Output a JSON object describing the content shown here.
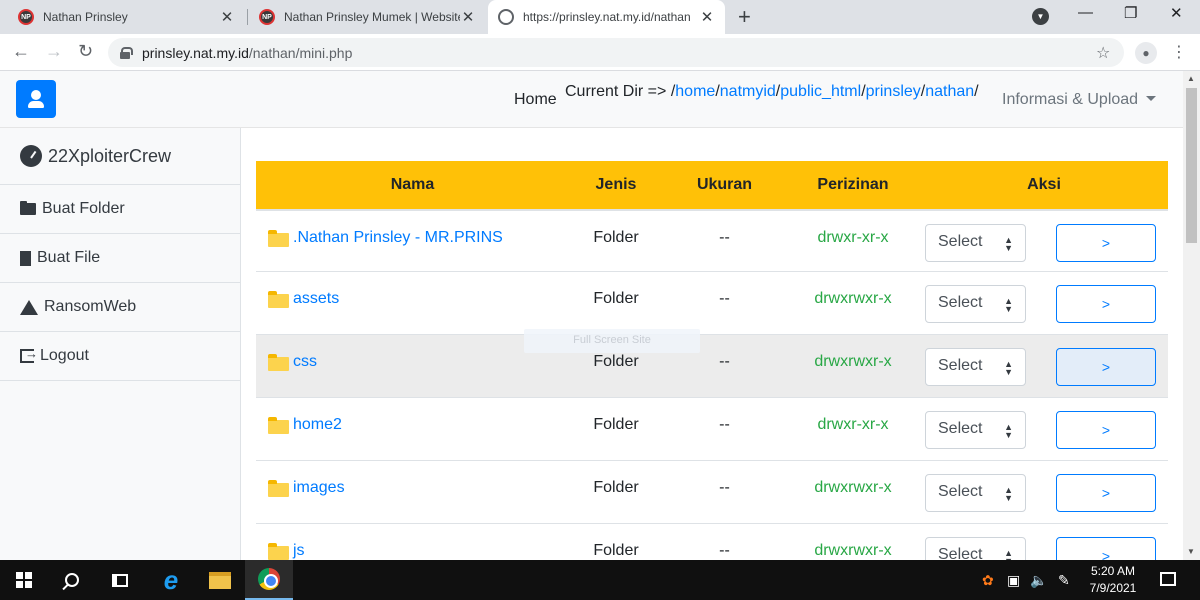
{
  "browser": {
    "tabs": [
      {
        "title": "Nathan Prinsley",
        "fav": "NP"
      },
      {
        "title": "Nathan Prinsley Mumek | Website",
        "fav": "NP"
      },
      {
        "title": "https://prinsley.nat.my.id/nathan",
        "fav": ""
      }
    ],
    "url_host": "prinsley.nat.my.id",
    "url_path": "/nathan/mini.php"
  },
  "topnav": {
    "home": "Home",
    "current_dir_label": "Current Dir =>",
    "path_sep": "/",
    "path_parts": [
      "home",
      "natmyid",
      "public_html",
      "prinsley",
      "nathan"
    ],
    "info_upload": "Informasi & Upload"
  },
  "sidebar": {
    "brand": "22XploiterCrew",
    "items": [
      {
        "label": "Buat Folder",
        "icon": "folder-open-icon"
      },
      {
        "label": "Buat File",
        "icon": "file-icon"
      },
      {
        "label": "RansomWeb",
        "icon": "warning-icon"
      },
      {
        "label": "Logout",
        "icon": "sign-out-icon"
      }
    ]
  },
  "table": {
    "headers": {
      "nama": "Nama",
      "jenis": "Jenis",
      "ukuran": "Ukuran",
      "perizinan": "Perizinan",
      "aksi": "Aksi"
    },
    "select_label": "Select",
    "go_label": ">",
    "rows": [
      {
        "name": ".Nathan Prinsley - MR.PRINS",
        "type": "Folder",
        "size": "--",
        "perm": "drwxr-xr-x"
      },
      {
        "name": "assets",
        "type": "Folder",
        "size": "--",
        "perm": "drwxrwxr-x"
      },
      {
        "name": "css",
        "type": "Folder",
        "size": "--",
        "perm": "drwxrwxr-x"
      },
      {
        "name": "home2",
        "type": "Folder",
        "size": "--",
        "perm": "drwxr-xr-x"
      },
      {
        "name": "images",
        "type": "Folder",
        "size": "--",
        "perm": "drwxrwxr-x"
      },
      {
        "name": "js",
        "type": "Folder",
        "size": "--",
        "perm": "drwxrwxr-x"
      }
    ]
  },
  "overlay": {
    "fullscreen_hint": "Full Screen Site"
  },
  "taskbar": {
    "time": "5:20 AM",
    "date": "7/9/2021"
  },
  "colors": {
    "accent": "#007bff",
    "table_header": "#ffc107",
    "permission": "#28a745"
  }
}
